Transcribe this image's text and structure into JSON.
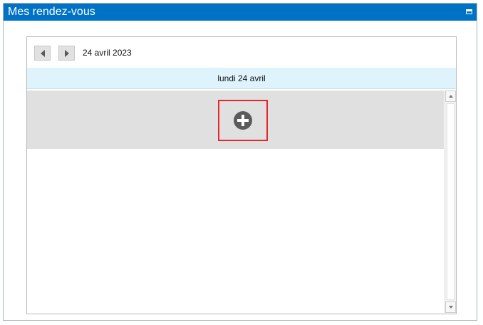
{
  "panel": {
    "title": "Mes rendez-vous",
    "minimize_icon": "minimize-icon"
  },
  "calendar": {
    "date_label": "24 avril 2023",
    "prev_icon": "chevron-left-icon",
    "next_icon": "chevron-right-icon",
    "day_header": "lundi 24 avril",
    "add_icon": "plus-circle-icon"
  },
  "colors": {
    "titlebar": "#0072c6",
    "day_header_bg": "#dff3fd",
    "slot_bg": "#e0e0e0",
    "highlight": "#e8262a"
  }
}
